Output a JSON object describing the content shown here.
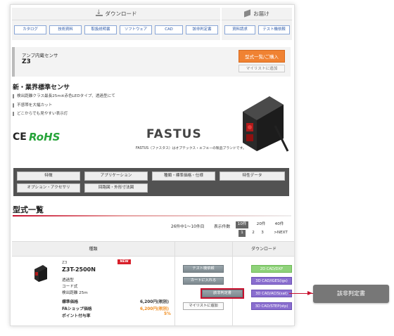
{
  "download": {
    "title": "ダウンロード",
    "buttons": [
      "カタログ",
      "技術資料",
      "取扱説明書",
      "ソフトウェア",
      "CAD",
      "該非判定書"
    ]
  },
  "delivery": {
    "title": "お届け",
    "buttons": [
      "資料請求",
      "テスト機依頼"
    ]
  },
  "product": {
    "category": "アンプ内蔵センサ",
    "name": "Z3",
    "list_button": "型式一覧/ご購入",
    "mylist_button": "マイリストに追加"
  },
  "intro": {
    "title": "新・業界標準センサ",
    "bullets": [
      "検出距離クラス最長25m※赤色LEDタイプ、透過型にて",
      "不感帯を大幅カット",
      "どこからでも見やすい表示灯"
    ]
  },
  "logos": {
    "ce": "CE",
    "rohs": "RoHS",
    "fastus": "FASTUS",
    "fastus_caption": "FASTUS（ファスタス）はオプテックス・エフエーの製品ブランドです。"
  },
  "tabs": [
    "特徴",
    "アプリケーション",
    "種類・標準価格・仕様",
    "特性データ",
    "オプション・アクセサリ",
    "回路図・外形寸法図"
  ],
  "section": {
    "title": "型式一覧",
    "range_text": "26件中1〜10件目",
    "per_page_label": "表示件数",
    "per_page_options": [
      "10件",
      "20件",
      "40件"
    ],
    "per_page_selected": "10件",
    "pages": [
      "1",
      "2",
      "3"
    ],
    "current_page": "1",
    "next": ">NEXT"
  },
  "table": {
    "col_type": "種類",
    "col_download": "ダウンロード",
    "row": {
      "series": "Z3",
      "badge": "NEW",
      "model": "Z3T-2500N",
      "specs": [
        "透過型",
        "コード式",
        "検出距離 25m"
      ],
      "price_label": "標準価格",
      "price_value": "6,200円(税別)",
      "shop_label": "FAショップ価格",
      "shop_value": "6,200円(税別)",
      "point_label": "ポイント付与率",
      "point_value": "5%",
      "actions": [
        "テスト機依頼",
        "カートに入れる",
        "該非判定書",
        "マイリストに追加"
      ],
      "downloads": [
        "2D CAD/DXF",
        "3D CAD/IGES(igs)",
        "3D CAD/ACIS(sat)",
        "3D CAD/STEP(stp)"
      ]
    }
  },
  "callout": {
    "label": "該非判定書"
  },
  "colors": {
    "accent_orange": "#f08232",
    "price_orange": "#f08c1e",
    "highlight_red": "#c8102e",
    "rohs_green": "#27a43a",
    "link_blue": "#2d5aa8"
  }
}
